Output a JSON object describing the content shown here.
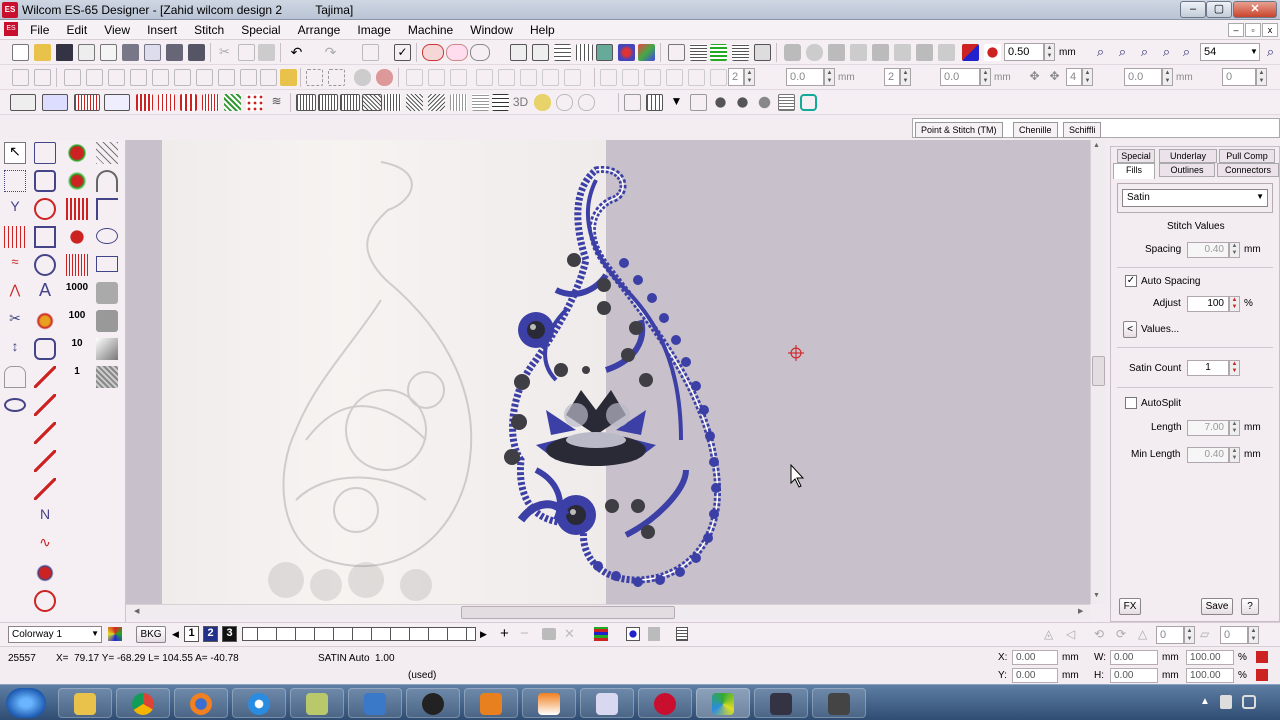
{
  "window": {
    "title": "Wilcom ES-65 Designer - [Zahid wilcom design 2          Tajima]",
    "app_icon_text": "ES",
    "controls": {
      "minimize": "–",
      "maximize": "▢",
      "close": "✕"
    }
  },
  "menu": {
    "items": [
      "File",
      "Edit",
      "View",
      "Insert",
      "Stitch",
      "Special",
      "Arrange",
      "Image",
      "Machine",
      "Window",
      "Help"
    ],
    "mdi_controls": {
      "minimize": "–",
      "restore": "▫",
      "close": "x"
    }
  },
  "toolbar1": {
    "zoom_value": "0.50",
    "zoom_unit": "mm",
    "stitch_count_value": "54"
  },
  "toolbar2": {
    "field1": "2",
    "field2": "0.0",
    "unit2": "mm",
    "field3": "2",
    "field4": "0.0",
    "unit4": "mm",
    "field5": "4",
    "field6": "0.0",
    "unit6": "mm",
    "field7": "0"
  },
  "toolbar3": {
    "label_3d": "3D"
  },
  "object_tabs": [
    "Point & Stitch (TM)",
    "Chenille",
    "Schiffli"
  ],
  "toolbox": {
    "icons": [
      "select-object-icon",
      "reshape-icon",
      "flower-icon",
      "parallel-lines-icon",
      "stitch-edit-icon",
      "shape-icon",
      "flower-icon-2",
      "arc-icon",
      "split-icon",
      "globe-icon",
      "satin-icon",
      "corner-icon",
      "run-icon",
      "lock-icon",
      "blob-icon",
      "ellipse-icon",
      "wave-icon",
      "globe-icon-2",
      "tatami-icon",
      "rectangle-icon",
      "zigzag-icon",
      "lettering-icon",
      "number-1000-icon",
      "stamp-icon",
      "cut-icon",
      "people-icon",
      "number-100-icon",
      "binoculars-icon",
      "measure-icon",
      "car-icon",
      "number-10-icon",
      "gradient-icon",
      "comb-icon",
      "line-icon",
      "number-1-icon",
      "texture-icon",
      "eye-icon",
      "dotted-line-icon",
      "diagonal-line-icon",
      "line-icon-2",
      "zigzag-line-icon",
      "corner-line-icon",
      "wave-line-icon",
      "node-icon",
      "disc-icon"
    ],
    "number_labels": {
      "n1000": "1000",
      "n100": "100",
      "n10": "10",
      "n1": "1",
      "letter_a": "A"
    }
  },
  "panel": {
    "tabs_top": [
      "Special",
      "Underlay",
      "Pull Comp"
    ],
    "tabs_bottom": [
      "Fills",
      "Outlines",
      "Connectors"
    ],
    "fill_type": "Satin",
    "section_title": "Stitch Values",
    "spacing_label": "Spacing",
    "spacing_value": "0.40",
    "spacing_unit": "mm",
    "auto_spacing_label": "Auto Spacing",
    "auto_spacing_checked": "✓",
    "adjust_label": "Adjust",
    "adjust_value": "100",
    "adjust_unit": "%",
    "values_button": "Values...",
    "values_arrow": "<",
    "satin_count_label": "Satin Count",
    "satin_count_value": "1",
    "autosplit_label": "AutoSplit",
    "length_label": "Length",
    "length_value": "7.00",
    "length_unit": "mm",
    "min_length_label": "Min Length",
    "min_length_value": "0.40",
    "min_length_unit": "mm",
    "fx_button": "FX",
    "save_button": "Save",
    "help_button": "?"
  },
  "bottom": {
    "colorway": "Colorway 1",
    "bkg_button": "BKG",
    "color_slots": [
      "1",
      "2",
      "3"
    ],
    "right_field1": "0",
    "right_field2": "0"
  },
  "status": {
    "stitch_number": "25557",
    "coords": "X=  79.17 Y= -68.29 L= 104.55 A= -40.78",
    "stitch_type": "SATIN Auto  1.00",
    "used": "(used)",
    "x_label": "X:",
    "x_value": "0.00",
    "x_unit": "mm",
    "w_label": "W:",
    "w_value": "0.00",
    "w_unit": "mm",
    "w_pct": "100.00",
    "w_pct_unit": "%",
    "y_label": "Y:",
    "y_value": "0.00",
    "y_unit": "mm",
    "h_label": "H:",
    "h_value": "0.00",
    "h_unit": "mm",
    "h_pct": "100.00",
    "h_pct_unit": "%"
  },
  "taskbar": {
    "start_icon": "windows-start-icon",
    "apps": [
      "file-explorer-icon",
      "chrome-icon",
      "firefox-icon",
      "internet-explorer-icon",
      "notepad-icon",
      "outlook-icon",
      "media-player-icon",
      "video-icon",
      "vlc-icon",
      "paint-icon",
      "wilcom-icon",
      "mixed-icon",
      "music-icon",
      "terminal-icon"
    ],
    "tray_arrow": "▲"
  },
  "colors": {
    "embroidery_blue": "#3b3fa6",
    "embroidery_dark": "#2a2a36",
    "canvas_bg": "#c8c1cc",
    "accent_red": "#c8102e"
  }
}
